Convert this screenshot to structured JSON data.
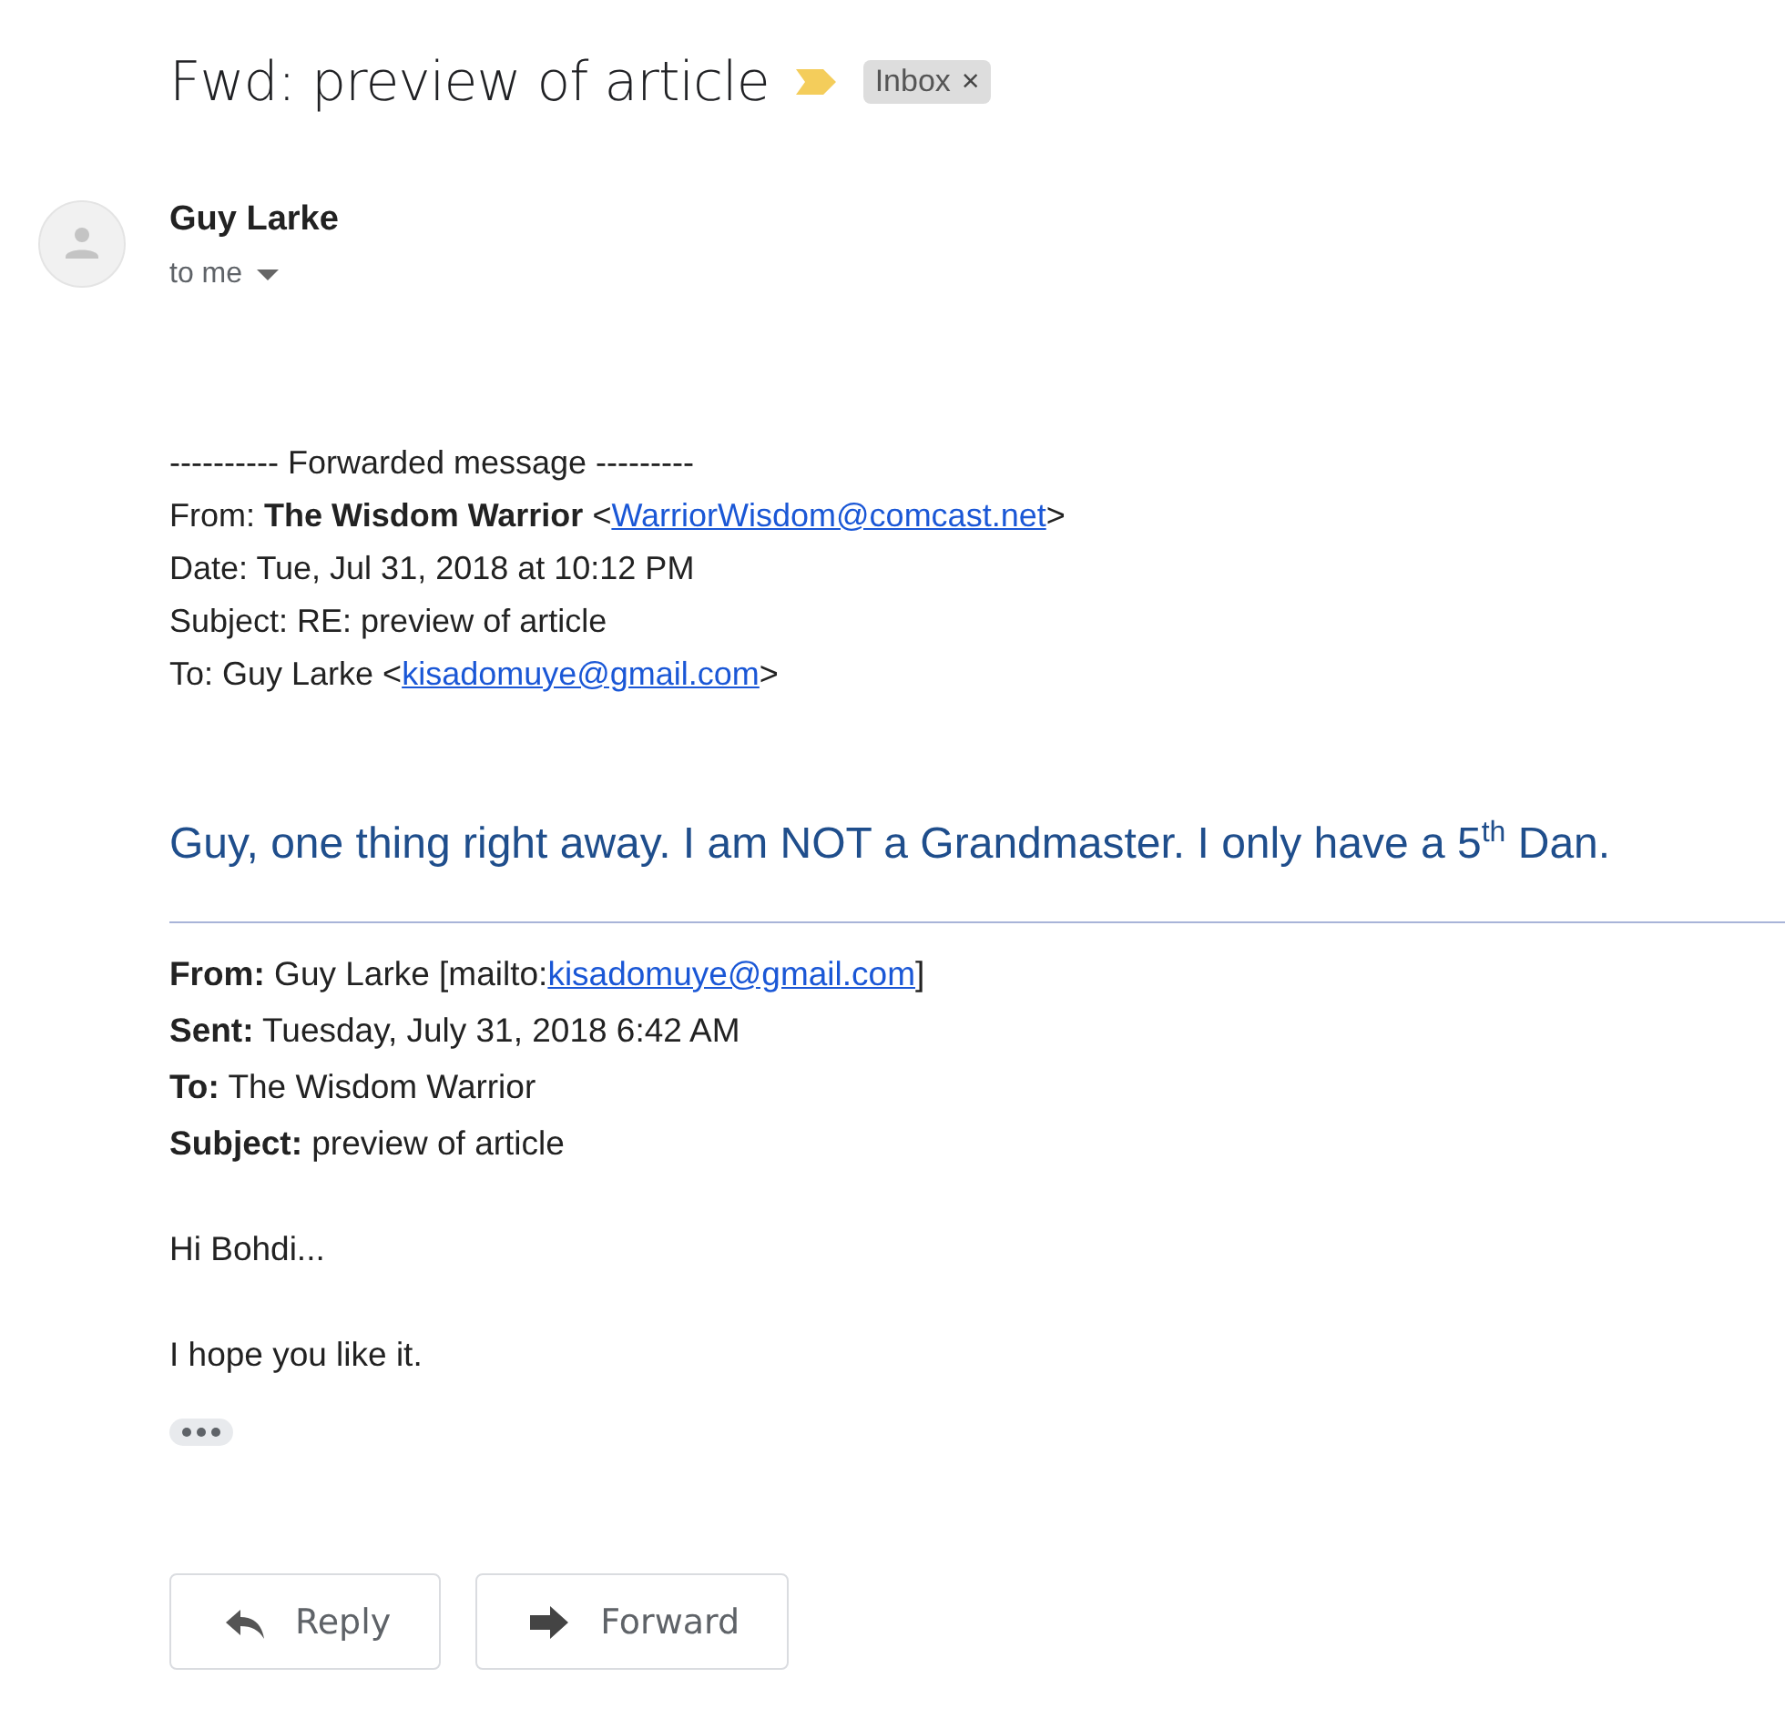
{
  "subject": "Fwd: preview of article",
  "important": true,
  "label": {
    "text": "Inbox",
    "close": "×"
  },
  "sender": {
    "name": "Guy Larke",
    "recipient": "to me"
  },
  "forwarded": [
    {
      "text": "---------- Forwarded message ---------"
    },
    {
      "text": "From: **The Wisdom Warrior** <",
      "link": "WarriorWisdom@comcast.net",
      "after": ">"
    },
    {
      "text": "Date: Tue, Jul 31, 2018 at 10:12 PM"
    },
    {
      "text": "Subject: RE: preview of article"
    },
    {
      "text": "To: Guy Larke <",
      "link": "kisadomuye@gmail.com",
      "after": ">"
    }
  ],
  "reply_text": "Guy, one thing right away. I am NOT a Grandmaster. I only have a 5$^{th}$ Dan.",
  "quoted_header": [
    {
      "text": "**From:** Guy Larke [mailto:",
      "link": "kisadomuye@gmail.com",
      "after": "]"
    },
    {
      "text": "**Sent:** Tuesday, July 31, 2018 6:42 AM"
    },
    {
      "text": "**To:** The Wisdom Warrior"
    },
    {
      "text": "**Subject:** preview of article"
    }
  ],
  "quoted_body": [
    "Hi Bohdi...",
    "I hope you like it."
  ],
  "trimmed_content": true,
  "buttons": [
    {
      "kind": "reply",
      "label": "Reply"
    },
    {
      "kind": "forward",
      "label": "Forward"
    }
  ]
}
